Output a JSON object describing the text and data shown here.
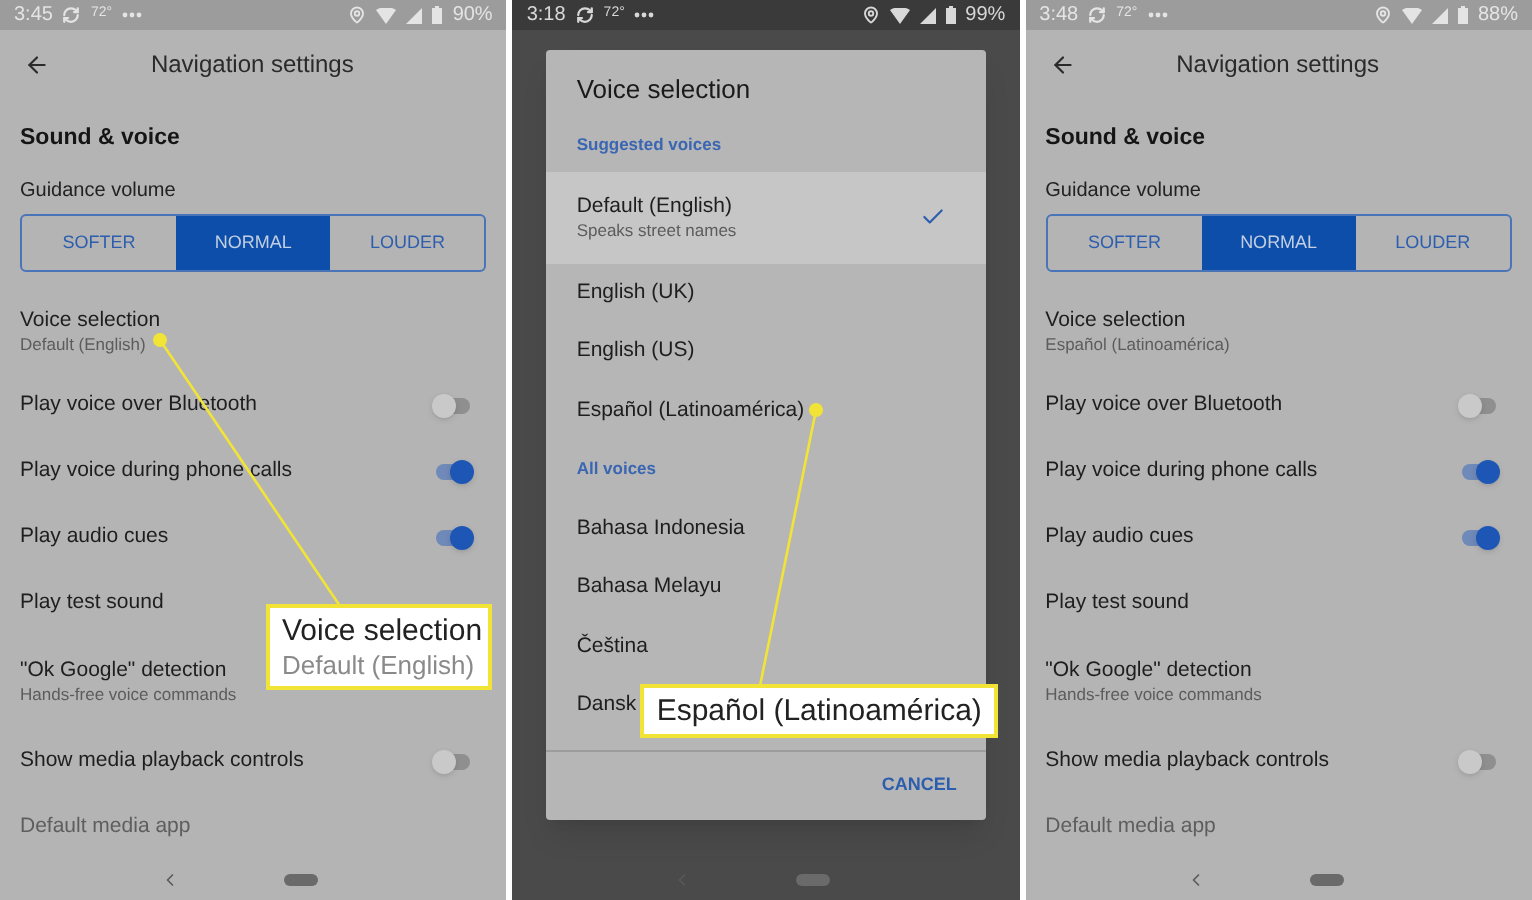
{
  "screens": [
    {
      "kind": "settings",
      "status_bar": {
        "time": "3:45",
        "temperature": "72°",
        "battery": "90%"
      },
      "header": {
        "title": "Navigation settings"
      },
      "section_title": "Sound & voice",
      "volume": {
        "label": "Guidance volume",
        "options": [
          {
            "label": "SOFTER",
            "selected": false
          },
          {
            "label": "NORMAL",
            "selected": true
          },
          {
            "label": "LOUDER",
            "selected": false
          }
        ]
      },
      "rows": [
        {
          "kind": "link",
          "title": "Voice selection",
          "subtitle": "Default (English)",
          "disabled": false
        },
        {
          "kind": "toggle",
          "title": "Play voice over Bluetooth",
          "on": false,
          "disabled": false
        },
        {
          "kind": "toggle",
          "title": "Play voice during phone calls",
          "on": true,
          "disabled": false
        },
        {
          "kind": "toggle",
          "title": "Play audio cues",
          "on": true,
          "disabled": false
        },
        {
          "kind": "link",
          "title": "Play test sound",
          "disabled": false
        },
        {
          "kind": "link",
          "title": "\"Ok Google\" detection",
          "subtitle": "Hands-free voice commands",
          "disabled": false
        },
        {
          "kind": "toggle",
          "title": "Show media playback controls",
          "on": false,
          "disabled": false
        },
        {
          "kind": "link",
          "title": "Default media app",
          "disabled": true
        }
      ],
      "callout": {
        "title": "Voice selection",
        "subtitle": "Default (English)"
      }
    },
    {
      "kind": "dialog",
      "status_bar": {
        "time": "3:18",
        "temperature": "72°",
        "battery": "99%"
      },
      "dialog": {
        "title": "Voice selection",
        "groups": [
          {
            "heading": "Suggested voices",
            "options": [
              {
                "label": "Default (English)",
                "subtitle": "Speaks street names",
                "selected": true
              },
              {
                "label": "English (UK)",
                "selected": false
              },
              {
                "label": "English (US)",
                "selected": false
              },
              {
                "label": "Español (Latinoamérica)",
                "selected": false
              }
            ]
          },
          {
            "heading": "All voices",
            "options": [
              {
                "label": "Bahasa Indonesia",
                "selected": false
              },
              {
                "label": "Bahasa Melayu",
                "selected": false
              },
              {
                "label": "Čeština",
                "selected": false
              },
              {
                "label": "Dansk",
                "selected": false
              }
            ]
          }
        ],
        "cancel": "CANCEL"
      },
      "callout": {
        "title": "Español (Latinoamérica)"
      }
    },
    {
      "kind": "settings",
      "status_bar": {
        "time": "3:48",
        "temperature": "72°",
        "battery": "88%"
      },
      "header": {
        "title": "Navigation settings"
      },
      "section_title": "Sound & voice",
      "volume": {
        "label": "Guidance volume",
        "options": [
          {
            "label": "SOFTER",
            "selected": false
          },
          {
            "label": "NORMAL",
            "selected": true
          },
          {
            "label": "LOUDER",
            "selected": false
          }
        ]
      },
      "rows": [
        {
          "kind": "link",
          "title": "Voice selection",
          "subtitle": "Español (Latinoamérica)",
          "disabled": false
        },
        {
          "kind": "toggle",
          "title": "Play voice over Bluetooth",
          "on": false,
          "disabled": false
        },
        {
          "kind": "toggle",
          "title": "Play voice during phone calls",
          "on": true,
          "disabled": false
        },
        {
          "kind": "toggle",
          "title": "Play audio cues",
          "on": true,
          "disabled": false
        },
        {
          "kind": "link",
          "title": "Play test sound",
          "disabled": false
        },
        {
          "kind": "link",
          "title": "\"Ok Google\" detection",
          "subtitle": "Hands-free voice commands",
          "disabled": false
        },
        {
          "kind": "toggle",
          "title": "Show media playback controls",
          "on": false,
          "disabled": false
        },
        {
          "kind": "link",
          "title": "Default media app",
          "disabled": true
        }
      ]
    }
  ]
}
